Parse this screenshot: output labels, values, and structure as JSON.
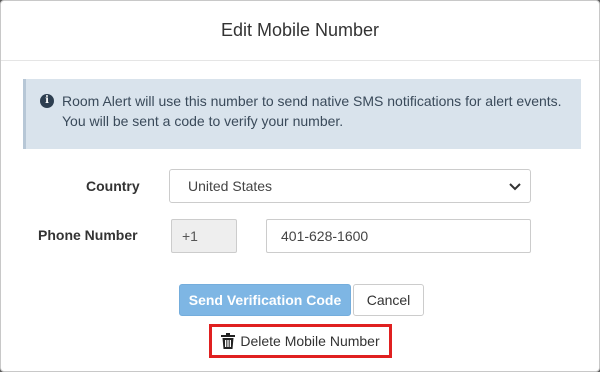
{
  "modal": {
    "title": "Edit Mobile Number"
  },
  "alert": {
    "icon": "info-icon",
    "message": "Room Alert will use this number to send native SMS notifications for alert events. You will be sent a code to verify your number."
  },
  "form": {
    "country_label": "Country",
    "country_value": "United States",
    "phone_label": "Phone Number",
    "phone_prefix": "+1",
    "phone_value": "401-628-1600"
  },
  "buttons": {
    "send_label": "Send Verification Code",
    "cancel_label": "Cancel",
    "delete_label": "Delete Mobile Number"
  },
  "colors": {
    "alert_bg": "#d9e3ec",
    "send_button": "#7eb6e4",
    "highlight_border": "#e02020"
  }
}
